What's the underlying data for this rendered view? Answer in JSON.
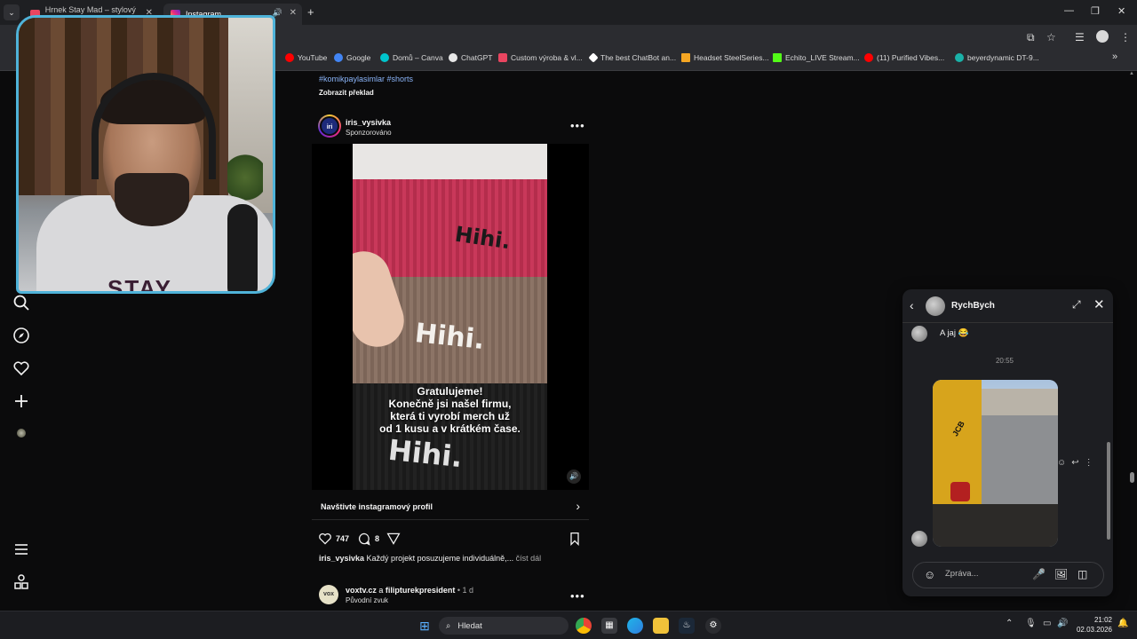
{
  "browser": {
    "tabs": [
      {
        "title": "Hrnek Stay Mad – stylový kera...",
        "icon_color": "#e94560"
      },
      {
        "title": "Instagram",
        "icon_color": "#d6249f"
      }
    ],
    "new_tab": "+",
    "window_controls": {
      "minimize": "—",
      "maximize": "❐",
      "close": "✕"
    },
    "bookmarks": [
      {
        "label": "YouTube",
        "color": "#ff0000"
      },
      {
        "label": "Google",
        "color": "#4285f4"
      },
      {
        "label": "Domů – Canva",
        "color": "#00c4cc"
      },
      {
        "label": "ChatGPT",
        "color": "#e8e8e8"
      },
      {
        "label": "Custom výroba & vl...",
        "color": "#e94560"
      },
      {
        "label": "The best ChatBot an...",
        "color": "#ffffff"
      },
      {
        "label": "Headset SteelSeries...",
        "color": "#f5a623"
      },
      {
        "label": "Echito_LIVE Stream...",
        "color": "#53fc18"
      },
      {
        "label": "(11) Purified Vibes...",
        "color": "#ff0000"
      },
      {
        "label": "beyerdynamic DT-9...",
        "color": "#1ab2a8"
      }
    ],
    "bookmarks_overflow": "»"
  },
  "feed": {
    "prev_post": {
      "hashtags": "#komikpaylasimlar #shorts",
      "translate_label": "Zobrazit překlad"
    },
    "post": {
      "avatar_letter": "iri",
      "username": "iris_vysivka",
      "subtitle": "Sponzorováno",
      "more": "•••",
      "image": {
        "brand_text": "Hihi.",
        "promo_line1": "Gratulujeme!",
        "promo_line2": "Konečně jsi našel firmu,",
        "promo_line3": "která ti vyrobí merch už",
        "promo_line4": "od 1 kusu a v krátkém čase."
      },
      "cta_label": "Navštivte instagramový profil",
      "likes": "747",
      "comments": "8",
      "caption_user": "iris_vysivka",
      "caption_text": " Každý projekt posuzujeme individuálně,...",
      "caption_more": " číst dál"
    },
    "next_post": {
      "avatar_text": "vox",
      "user1": "voxtv.cz",
      "joiner": " a ",
      "user2": "filipturekpresident",
      "time": " • 1 d",
      "audio": "Původní zvuk",
      "more": "•••"
    }
  },
  "chat": {
    "name": "RychBych",
    "message_text": "A jaj 😂",
    "time": "20:55",
    "photo_brand": "JCB",
    "composer_placeholder": "Zpráva..."
  },
  "webcam": {
    "shirt_text": "STAY"
  },
  "taskbar": {
    "search_label": "Hledat",
    "time": "21:02",
    "date": "02.03.2026"
  }
}
